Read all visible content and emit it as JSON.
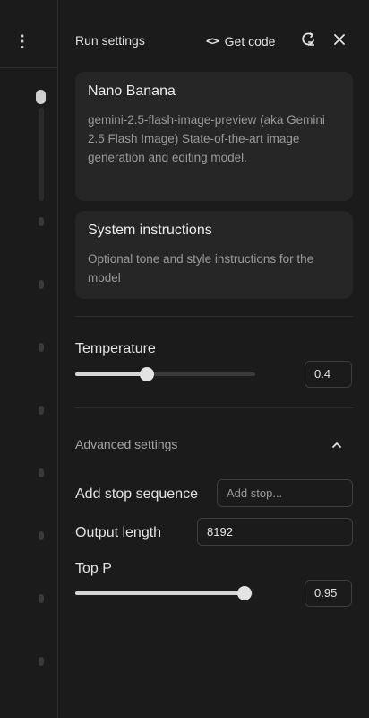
{
  "header": {
    "title": "Run settings",
    "get_code_label": "Get code",
    "code_icon": "<>",
    "reset_icon": "reset-icon",
    "close_icon": "close-icon"
  },
  "model_card": {
    "name": "Nano Banana",
    "description": "gemini-2.5-flash-image-preview (aka Gemini 2.5 Flash Image) State-of-the-art image generation and editing model."
  },
  "system_instructions": {
    "title": "System instructions",
    "placeholder": "Optional tone and style instructions for the model"
  },
  "temperature": {
    "label": "Temperature",
    "value": "0.4",
    "slider_fraction": 0.4
  },
  "advanced": {
    "label": "Advanced settings",
    "expanded": true
  },
  "stop_sequence": {
    "label": "Add stop sequence",
    "placeholder": "Add stop..."
  },
  "output_length": {
    "label": "Output length",
    "value": "8192"
  },
  "top_p": {
    "label": "Top P",
    "value": "0.95",
    "slider_fraction": 0.95
  },
  "colors": {
    "background": "#1b1b1b",
    "card": "#262626",
    "text": "#e3e3e3",
    "muted": "#9a9a9a"
  }
}
